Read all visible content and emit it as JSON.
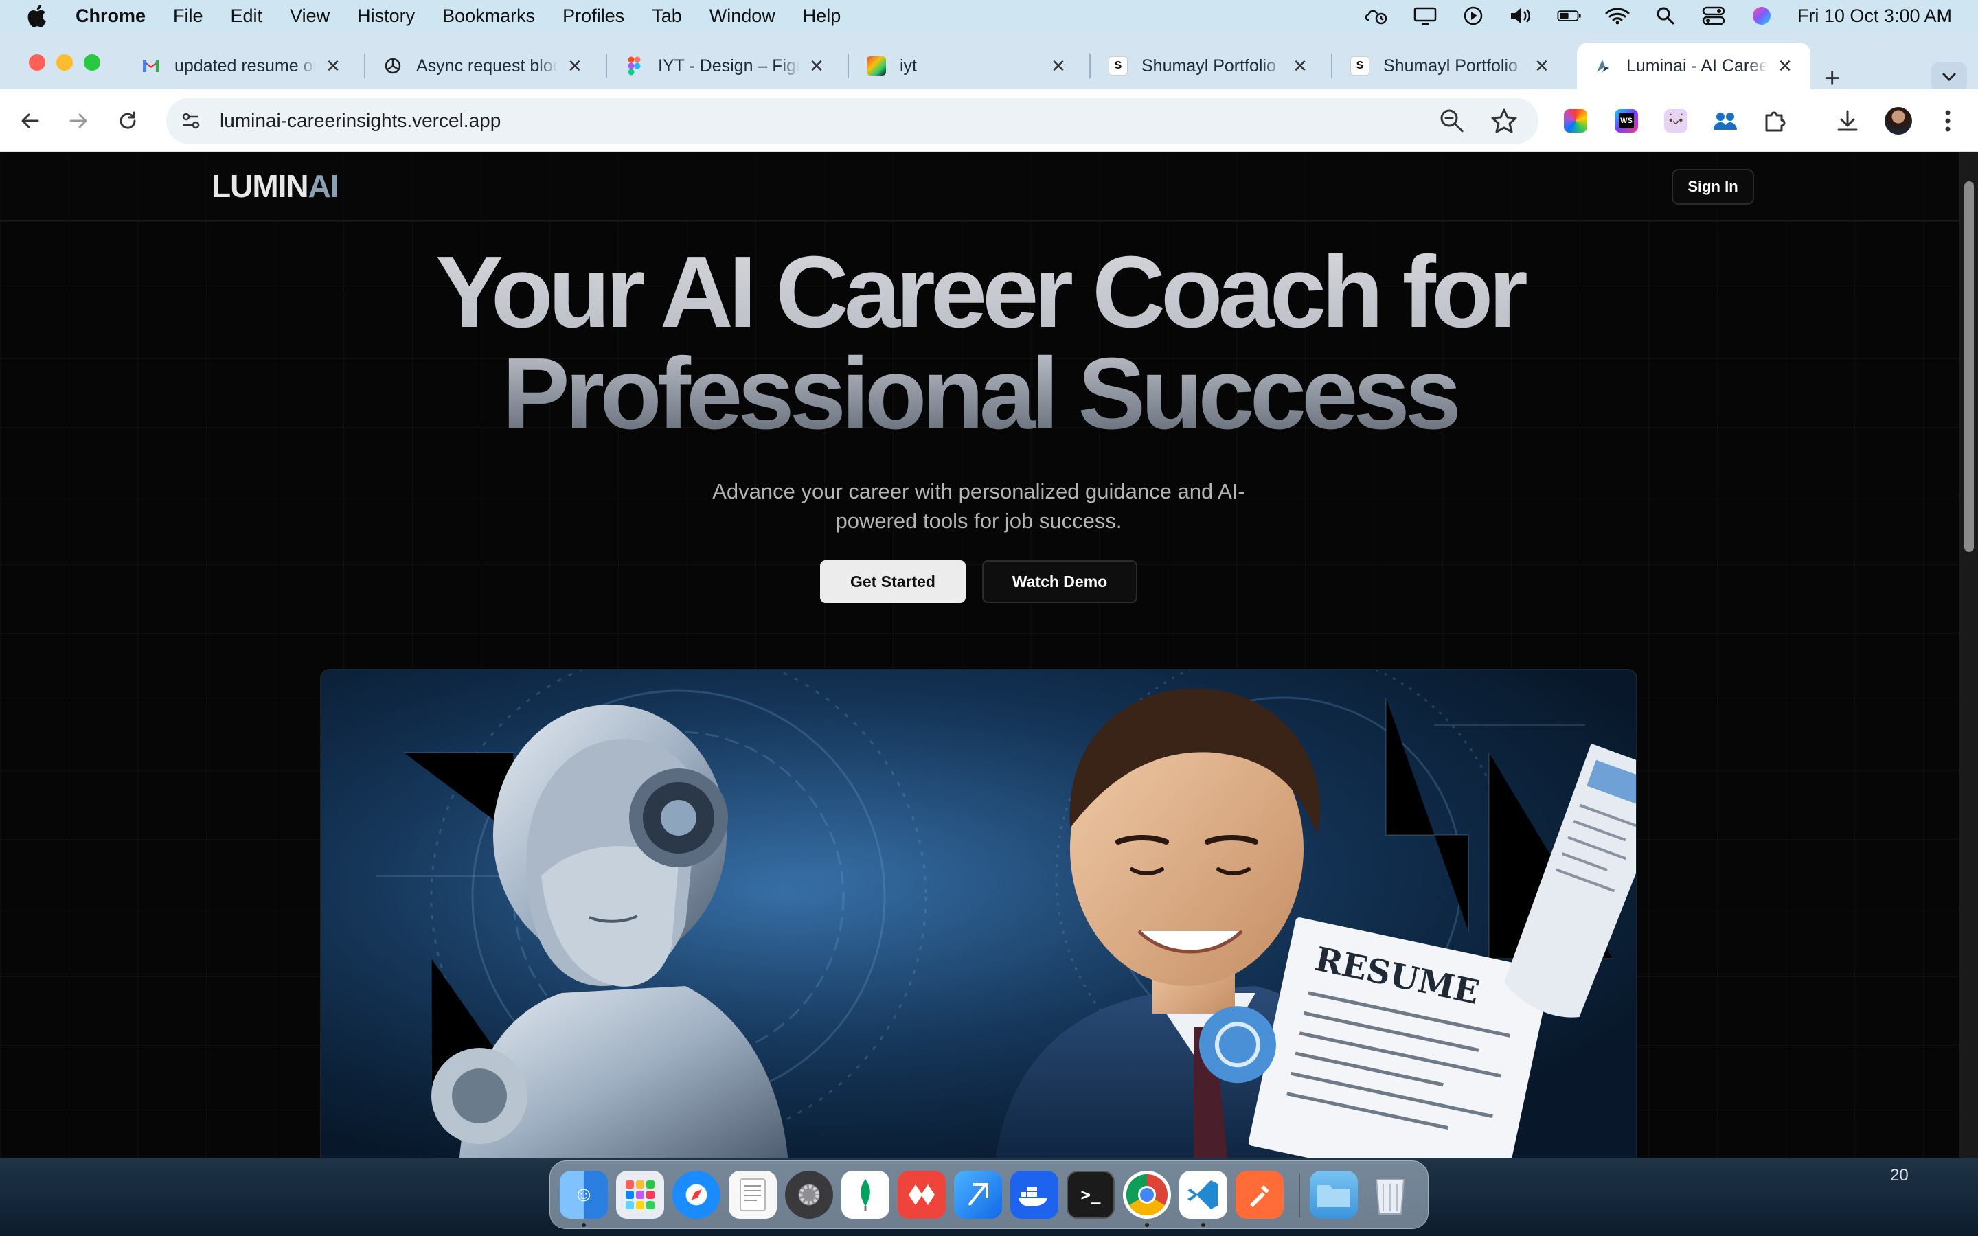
{
  "menubar": {
    "app_name": "Chrome",
    "items": [
      "File",
      "Edit",
      "View",
      "History",
      "Bookmarks",
      "Profiles",
      "Tab",
      "Window",
      "Help"
    ],
    "clock": "Fri 10 Oct  3:00 AM",
    "status_icons": [
      "weather-icon",
      "display-icon",
      "play-icon",
      "volume-icon",
      "battery-icon",
      "wifi-icon",
      "search-icon",
      "control-center-icon",
      "siri-icon"
    ]
  },
  "tabs": [
    {
      "title": "updated resume on",
      "favicon": "gmail-icon"
    },
    {
      "title": "Async request blocking",
      "favicon": "chatgpt-icon"
    },
    {
      "title": "IYT - Design – Figma",
      "favicon": "figma-icon"
    },
    {
      "title": "iyt",
      "favicon": "iyt-icon"
    },
    {
      "title": "Shumayl Portfolio",
      "favicon": "portfolio-icon"
    },
    {
      "title": "Shumayl Portfolio",
      "favicon": "portfolio-icon"
    },
    {
      "title": "Luminai - AI Career",
      "favicon": "luminai-icon",
      "active": true
    }
  ],
  "toolbar": {
    "url": "luminai-careerinsights.vercel.app"
  },
  "site": {
    "logo_lum": "LUMIN",
    "logo_ai": "AI",
    "sign_in": "Sign In",
    "hero_line1": "Your AI Career Coach for",
    "hero_line2": "Professional Success",
    "hero_subtitle": "Advance your career with personalized guidance and AI-powered tools for job success.",
    "btn_get_started": "Get Started",
    "btn_watch_demo": "Watch Demo",
    "hero_image_text": "RESUME"
  },
  "dock": {
    "apps": [
      "Finder",
      "Launchpad",
      "Safari",
      "TextEdit",
      "System Settings",
      "MongoDB Compass",
      "AnyDesk",
      "Xcode",
      "Docker",
      "Terminal",
      "Google Chrome",
      "Visual Studio Code",
      "Postman",
      "Downloads",
      "Trash"
    ]
  },
  "desktop_corner_number": "20",
  "colors": {
    "menubar_bg": "#cfe5f2",
    "tabstrip_bg": "#d5e4f1",
    "page_bg": "#060606",
    "accent_ai": "#8aa0b4"
  }
}
